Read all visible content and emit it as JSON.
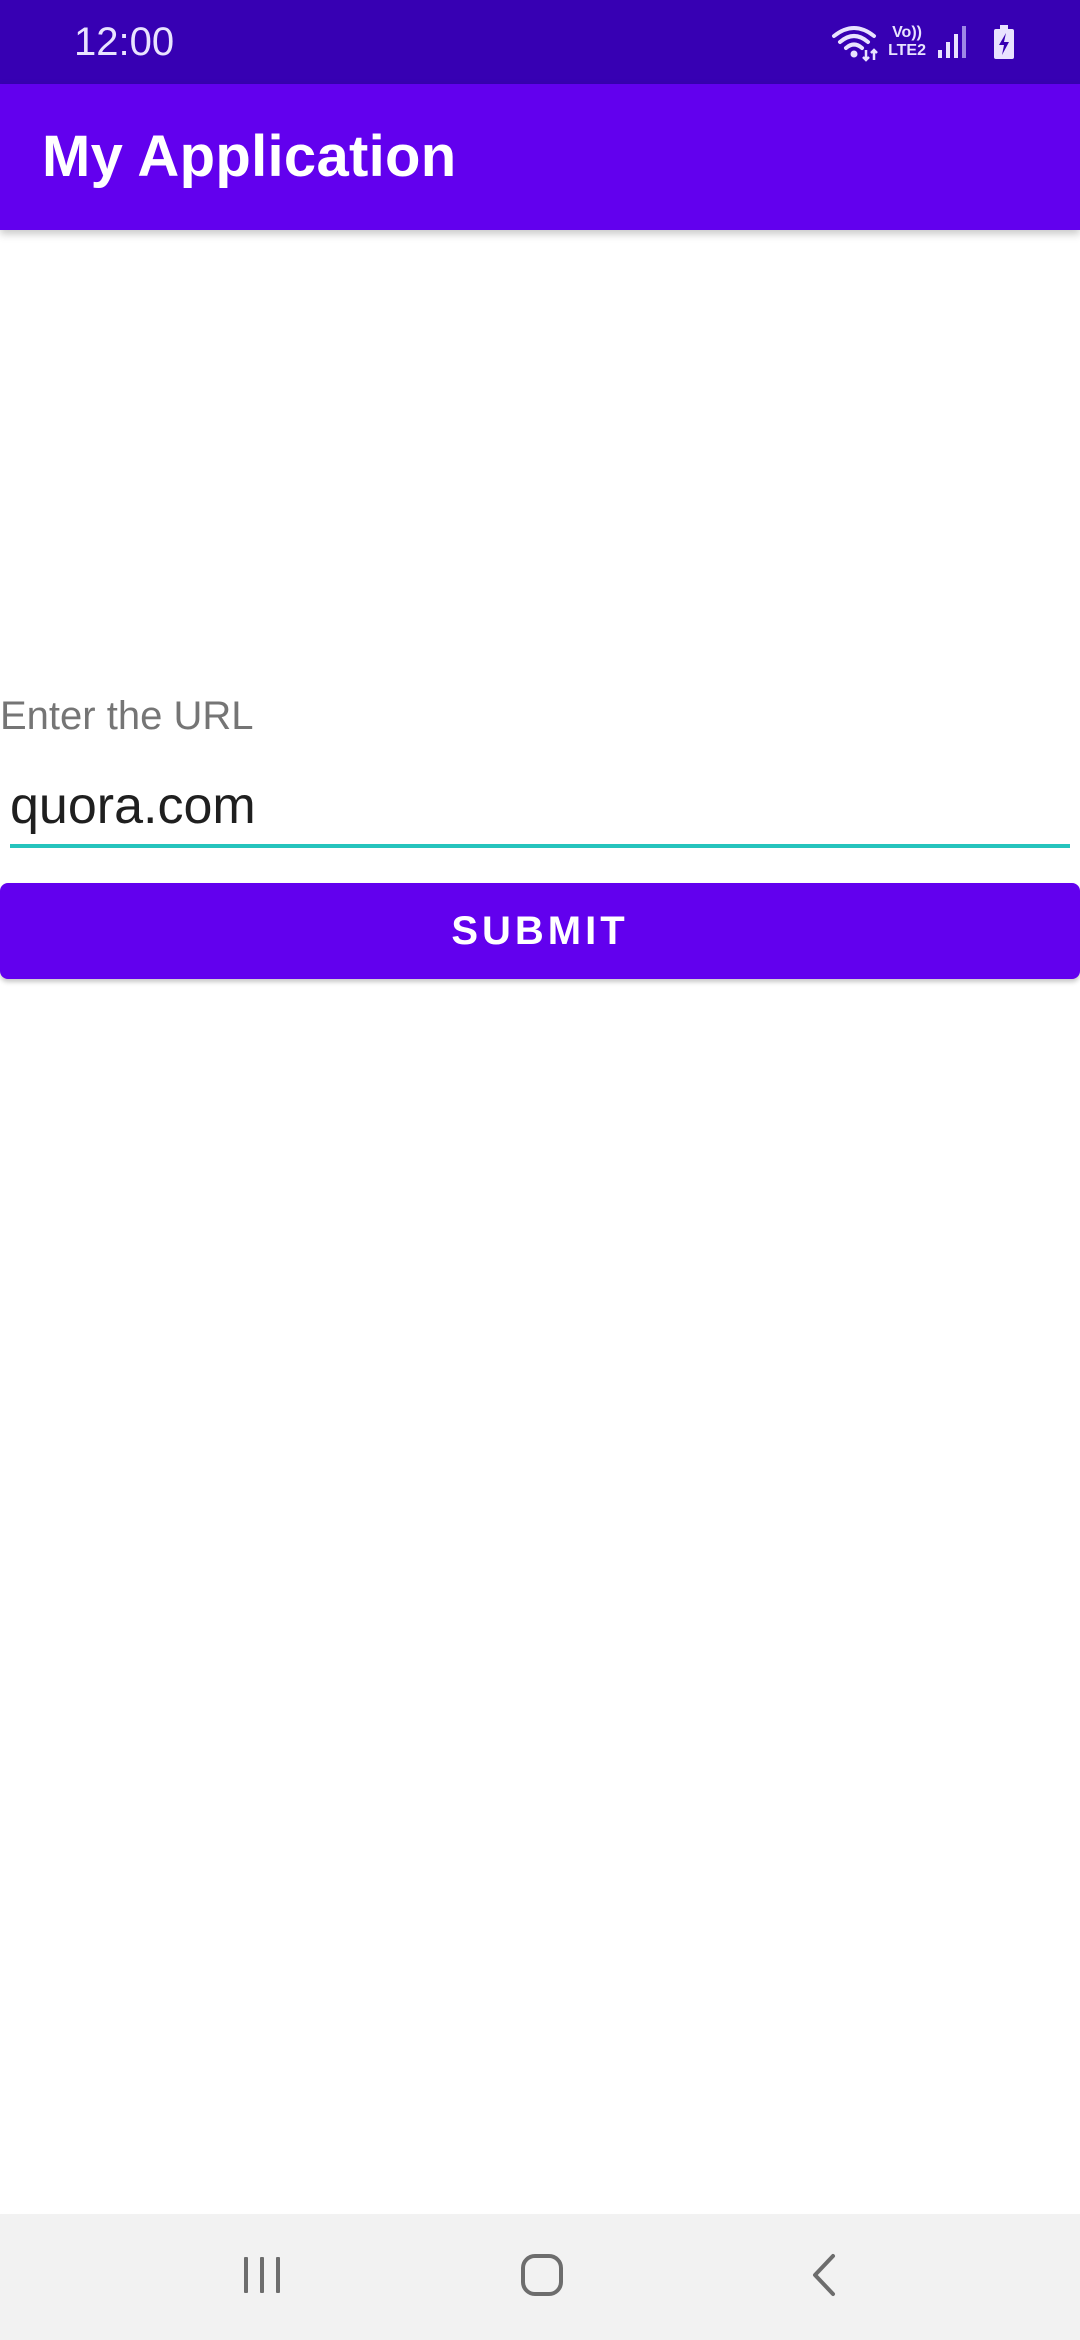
{
  "status_bar": {
    "time": "12:00",
    "icons": [
      "wifi-icon",
      "volte-icon",
      "signal-icon",
      "battery-charging-icon"
    ],
    "volte_top": "Vo))",
    "volte_bottom": "LTE2"
  },
  "app_bar": {
    "title": "My Application"
  },
  "form": {
    "label": "Enter the URL",
    "url_value": "quora.com",
    "submit_label": "SUBMIT"
  },
  "nav_bar": {
    "icons": [
      "recents-icon",
      "home-icon",
      "back-icon"
    ]
  },
  "colors": {
    "status_bar": "#3700b3",
    "primary": "#6200ee",
    "accent": "#25c4bd",
    "nav_bar": "#f2f2f2"
  }
}
